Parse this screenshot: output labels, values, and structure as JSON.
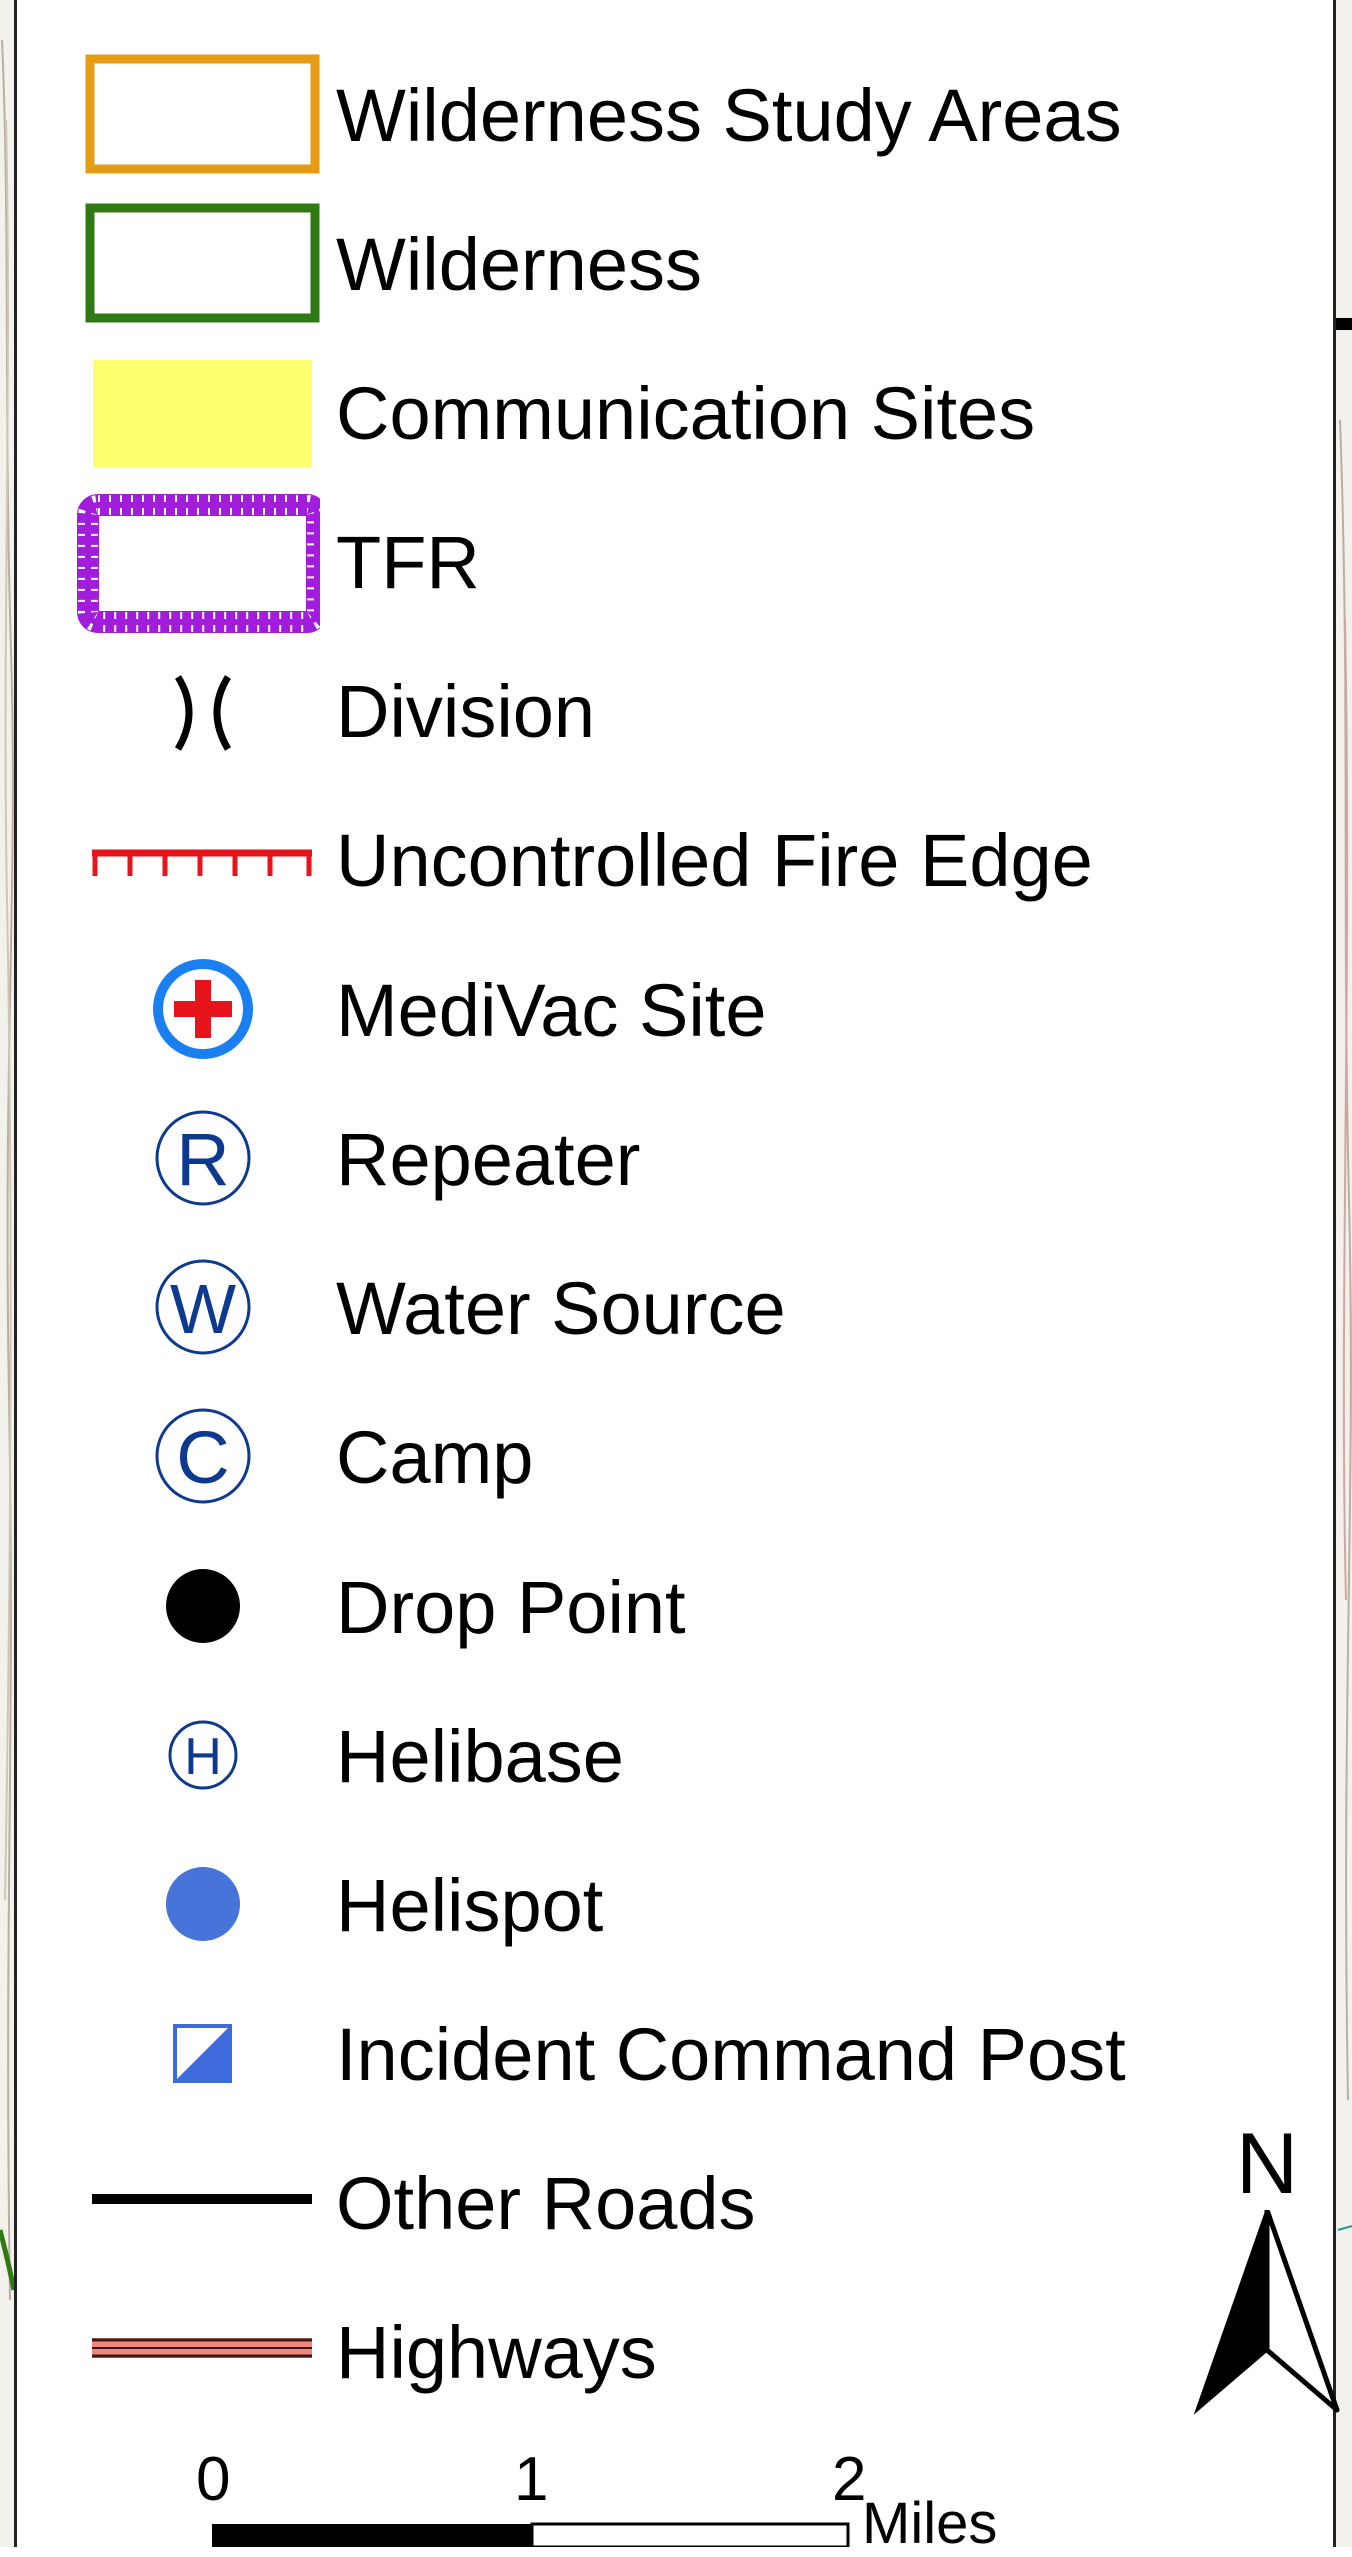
{
  "legend": {
    "items": [
      {
        "label": "Wilderness Study Areas",
        "icon": "wilderness-study-area-swatch-icon",
        "color": "#e59c15"
      },
      {
        "label": "Wilderness",
        "icon": "wilderness-swatch-icon",
        "color": "#2f7a12"
      },
      {
        "label": "Communication Sites",
        "icon": "communication-site-swatch-icon",
        "color": "#ffff72"
      },
      {
        "label": "TFR",
        "icon": "tfr-swatch-icon",
        "color": "#a21ddb"
      },
      {
        "label": "Division",
        "icon": "division-break-icon",
        "color": "#000000"
      },
      {
        "label": "Uncontrolled Fire Edge",
        "icon": "uncontrolled-fire-edge-line-icon",
        "color": "#e8141b"
      },
      {
        "label": "MediVac Site",
        "icon": "medivac-cross-icon",
        "color": "#1a7ff0"
      },
      {
        "label": "Repeater",
        "icon": "repeater-r-icon",
        "color": "#0d3a8e"
      },
      {
        "label": "Water Source",
        "icon": "water-source-w-icon",
        "color": "#0d3a8e"
      },
      {
        "label": "Camp",
        "icon": "camp-c-icon",
        "color": "#0d3a8e"
      },
      {
        "label": "Drop Point",
        "icon": "drop-point-dot-icon",
        "color": "#000000"
      },
      {
        "label": "Helibase",
        "icon": "helibase-h-icon",
        "color": "#0d3a8e"
      },
      {
        "label": "Helispot",
        "icon": "helispot-dot-icon",
        "color": "#4774d9"
      },
      {
        "label": "Incident Command Post",
        "icon": "incident-command-post-icon",
        "color": "#3d6bdb"
      },
      {
        "label": "Other Roads",
        "icon": "other-road-line-icon",
        "color": "#000000"
      },
      {
        "label": "Highways",
        "icon": "highway-line-icon",
        "color": "#f4877c"
      }
    ]
  },
  "north_arrow": {
    "letter": "N"
  },
  "scale_bar": {
    "ticks": [
      "0",
      "1",
      "2"
    ],
    "units": "Miles"
  }
}
